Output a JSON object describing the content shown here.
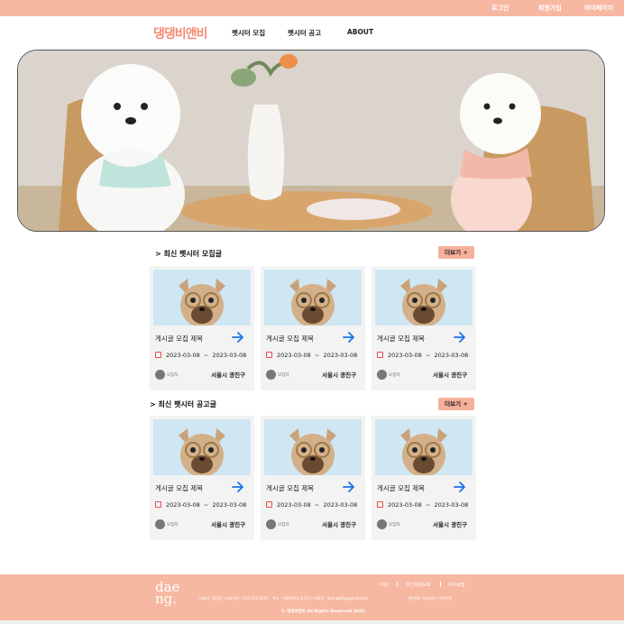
{
  "topbar": {
    "login": "로그인",
    "signup": "회원가입",
    "mypage": "마이페이지"
  },
  "nav": {
    "logo": "댕댕비앤비",
    "links": [
      "펫시터 모집",
      "펫시터 공고",
      "ABOUT"
    ]
  },
  "colors": {
    "accent": "#f7b8a2",
    "button": "#f7b09a",
    "calendar": "#e94b4b",
    "arrow": "#1a73e8"
  },
  "recruit": {
    "title": "> 최신 펫시터 모집글",
    "more": "더보기 +",
    "cards": [
      {
        "title": "게시글 모집 제목",
        "start": "2023-03-08",
        "end": "2023-03-08",
        "user": "모집자",
        "location": "서울시 광진구"
      },
      {
        "title": "게시글 모집 제목",
        "start": "2023-03-08",
        "end": "2023-03-08",
        "user": "모집자",
        "location": "서울시 광진구"
      },
      {
        "title": "게시글 모집 제목",
        "start": "2023-03-08",
        "end": "2023-03-08",
        "user": "모집자",
        "location": "서울시 광진구"
      }
    ]
  },
  "notice": {
    "title": "> 최신 펫시터 공고글",
    "more": "더보기 +",
    "cards": [
      {
        "title": "게시글 모집 제목",
        "start": "2023-03-08",
        "end": "2023-03-08",
        "user": "모집자",
        "location": "서울시 광진구"
      },
      {
        "title": "게시글 모집 제목",
        "start": "2023-03-08",
        "end": "2023-03-08",
        "user": "모집자",
        "location": "서울시 광진구"
      },
      {
        "title": "게시글 모집 제목",
        "start": "2023-03-08",
        "end": "2023-03-08",
        "user": "모집자",
        "location": "서울시 광진구"
      }
    ]
  },
  "date_sep": "~",
  "footer": {
    "logo_line1": "dae",
    "logo_line2": "ng.",
    "links": [
      "약관",
      "개인정보보호",
      "사이트맵"
    ],
    "info_left": "대표자 : 홍길동 | 대표번호 : 010-123-4567",
    "info_mid": "주소 : 서울특별시 광진구 | 이메일 : daengbnb@gmail.com",
    "info_right": "개인정보 처리방침 | 이용약관",
    "copyright": "© 댕댕비앤비 All Rights Reserved 2023."
  }
}
